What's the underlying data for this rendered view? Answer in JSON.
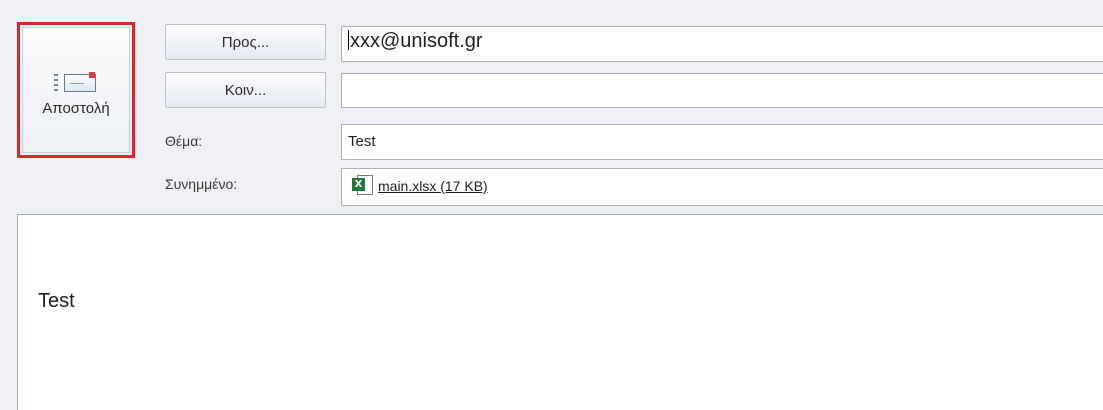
{
  "compose": {
    "send_label": "Αποστολή",
    "to_button_label": "Προς...",
    "cc_button_label": "Κοιν...",
    "subject_label": "Θέμα:",
    "attachment_label": "Συνημμένο:",
    "to_value": "xxx@unisoft.gr",
    "cc_value": "",
    "subject_value": "Test",
    "attachment": {
      "icon": "excel-file-icon",
      "badge": "X",
      "name": "main.xlsx (17 KB)"
    },
    "body_text": "Test"
  },
  "colors": {
    "highlight_border": "#e0222b",
    "excel_green": "#1f7a3c"
  }
}
